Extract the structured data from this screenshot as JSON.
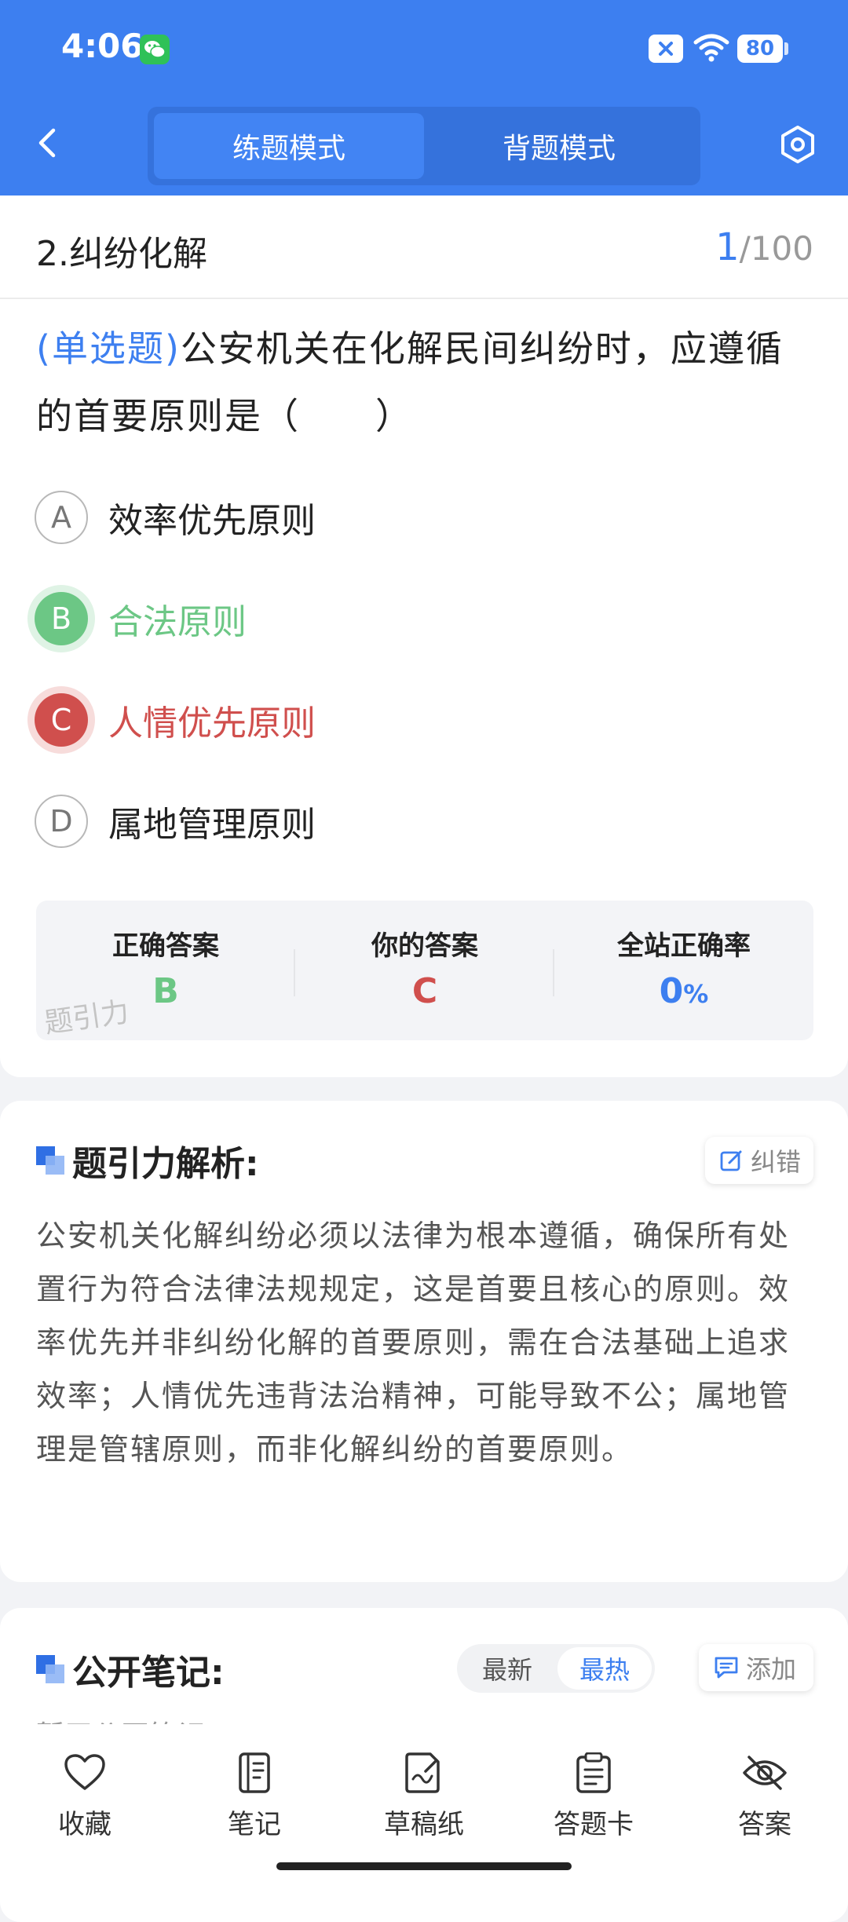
{
  "status_bar": {
    "time": "4:06",
    "battery": "80"
  },
  "header": {
    "modes": [
      "练题模式",
      "背题模式"
    ],
    "active_mode": "练题模式"
  },
  "question_header": {
    "chapter": "2.纠纷化解",
    "current": "1",
    "total": "/100"
  },
  "question": {
    "type_label": "(单选题)",
    "text": "公安机关在化解民间纠纷时，应遵循的首要原则是（　　）",
    "options": [
      {
        "letter": "A",
        "text": "效率优先原则",
        "state": "normal"
      },
      {
        "letter": "B",
        "text": "合法原则",
        "state": "correct"
      },
      {
        "letter": "C",
        "text": "人情优先原则",
        "state": "wrong"
      },
      {
        "letter": "D",
        "text": "属地管理原则",
        "state": "normal"
      }
    ]
  },
  "result": {
    "correct_label": "正确答案",
    "correct_value": "B",
    "mine_label": "你的答案",
    "mine_value": "C",
    "rate_label": "全站正确率",
    "rate_value": "0",
    "rate_unit": "%",
    "watermark": "题引力"
  },
  "analysis": {
    "title": "题引力解析:",
    "report_label": "纠错",
    "text": "公安机关化解纠纷必须以法律为根本遵循，确保所有处置行为符合法律法规规定，这是首要且核心的原则。效率优先并非纠纷化解的首要原则，需在合法基础上追求效率；人情优先违背法治精神，可能导致不公；属地管理是管辖原则，而非化解纠纷的首要原则。"
  },
  "notes": {
    "title": "公开笔记:",
    "sort_newest": "最新",
    "sort_hottest": "最热",
    "add_label": "添加",
    "empty_text": "暂无公开笔记"
  },
  "bottom_nav": {
    "favorite": "收藏",
    "notes": "笔记",
    "draft": "草稿纸",
    "answer_card": "答题卡",
    "answer": "答案"
  },
  "colors": {
    "primary": "#3d7ff0",
    "correct": "#6cc785",
    "wrong": "#d04f4d"
  }
}
